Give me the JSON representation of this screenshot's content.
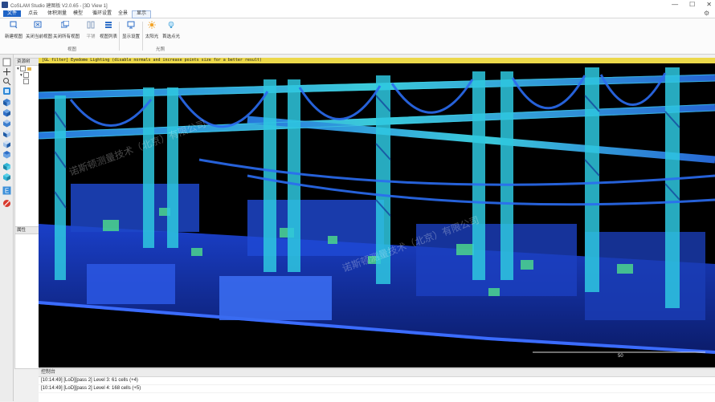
{
  "window": {
    "title": "CoSLAM Studio 建图板 V2.0.65 - [3D View 1]",
    "min": "—",
    "max": "☐",
    "close": "✕"
  },
  "menu": [
    {
      "label": "文件"
    },
    {
      "label": "点云"
    },
    {
      "label": "体积测量"
    },
    {
      "label": "模型"
    },
    {
      "label": "循环设置"
    },
    {
      "label": "全景"
    },
    {
      "label": "显示"
    }
  ],
  "ribbon": {
    "buttons": [
      {
        "label": "新建视图"
      },
      {
        "label": "关闭当前视图"
      },
      {
        "label": "关闭所有视图"
      },
      {
        "label": "平铺"
      },
      {
        "label": "视图列表"
      },
      {
        "label": "显示设置"
      },
      {
        "label": "太阳光"
      },
      {
        "label": "首选点光"
      }
    ],
    "groups": [
      {
        "label": "视图"
      },
      {
        "label": "光照"
      }
    ]
  },
  "panels": {
    "resources_title": "资源树",
    "properties_title": "属性"
  },
  "viewport": {
    "banner": "[GL filter] Eyedome Lighting (disable normals and increase points size for a better result)",
    "watermark": "诺斯顿测量技术（北京）有限公司",
    "scale_value": "50"
  },
  "console": {
    "title": "控制台",
    "lines": [
      "[10:14:49] [LoD][pass 2] Level 3: 61 cells (+4)",
      "[10:14:49] [LoD][pass 2] Level 4: 168 cells (+5)"
    ]
  },
  "colors": {
    "accent": "#1e63c6",
    "banner": "#ecd84a",
    "cloud_blue": "#1f4fe0",
    "cloud_cyan": "#33d8e0",
    "cloud_green": "#4fe08a"
  },
  "icons": {
    "tb_check": "checkbox-icon",
    "tb_view": "view-icon",
    "gear": "gear-icon"
  }
}
